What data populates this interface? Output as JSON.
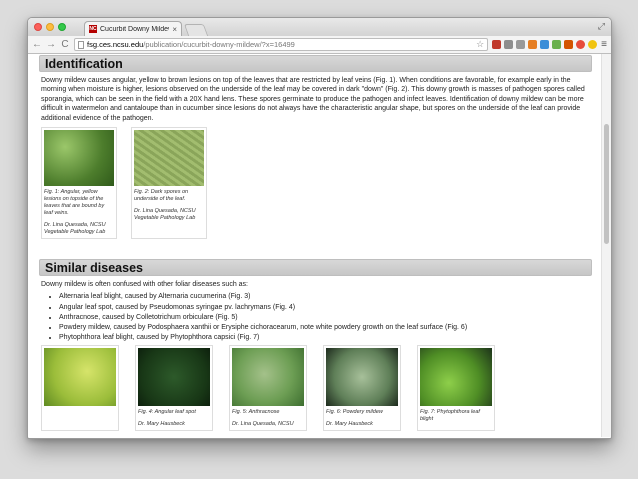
{
  "browser": {
    "tab_title": "Cucurbit Downy Mildew | F",
    "tab_close": "×",
    "favicon_text": "NC",
    "url_host": "fsg.ces.ncsu.edu",
    "url_path": "/publication/cucurbit-downy-mildew/?x=16499"
  },
  "identification": {
    "title": "Identification",
    "paragraph": "Downy mildew causes angular, yellow to brown lesions on top of the leaves that are restricted by leaf veins (Fig. 1). When conditions are favorable, for example early in the morning when moisture is higher, lesions observed on the underside of the leaf may be covered in dark \"down\" (Fig. 2). This downy growth is masses of pathogen spores called sporangia, which can be seen in the field with a 20X hand lens. These spores germinate to produce the pathogen and infect leaves. Identification of downy mildew can be more difficult in watermelon and cantaloupe than in cucumber since lesions do not always have the characteristic angular shape, but spores on the underside of the leaf can provide additional evidence of the pathogen.",
    "figures": [
      {
        "caption": "Fig. 1: Angular, yellow lesions on topside of the leaves that are bound by leaf veins.",
        "credit": "Dr. Lina Quesada, NCSU Vegetable Pathology Lab"
      },
      {
        "caption": "Fig. 2: Dark spores on underside of the leaf.",
        "credit": "Dr. Lina Quesada, NCSU Vegetable Pathology Lab"
      }
    ]
  },
  "similar": {
    "title": "Similar diseases",
    "intro": "Downy mildew is often confused with other foliar diseases such as:",
    "items": [
      "Alternaria leaf blight, caused by Alternaria cucumerina (Fig. 3)",
      "Angular leaf spot, caused by Pseudomonas syringae pv. lachrymans (Fig. 4)",
      "Anthracnose, caused by Colletotrichum orbiculare (Fig. 5)",
      "Powdery mildew, caused by Podosphaera xanthii or Erysiphe cichoracearum, note white powdery growth on the leaf surface (Fig. 6)",
      "Phytophthora leaf blight, caused by Phytophthora capsici (Fig. 7)"
    ],
    "figures": [
      {
        "caption": "",
        "credit": ""
      },
      {
        "caption": "Fig. 4: Angular leaf spot",
        "credit": "Dr. Mary Hausbeck"
      },
      {
        "caption": "Fig. 5: Anthracnose",
        "credit": "Dr. Lina Quesada, NCSU"
      },
      {
        "caption": "Fig. 6: Powdery mildew",
        "credit": "Dr. Mary Hausbeck"
      },
      {
        "caption": "Fig. 7: Phytophthora leaf blight",
        "credit": ""
      }
    ]
  }
}
